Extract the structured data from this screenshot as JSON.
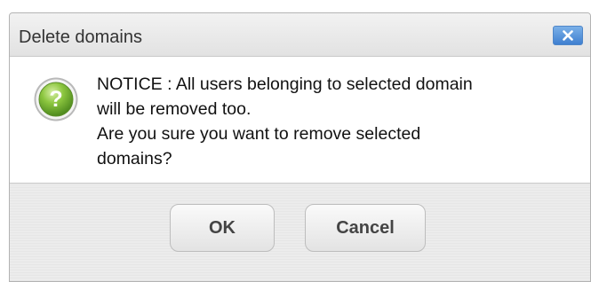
{
  "dialog": {
    "title": "Delete domains",
    "close_icon": "close-icon",
    "icon": "question-icon",
    "message_lines": [
      "NOTICE : All users belonging to selected domain",
      "will be removed too.",
      "Are you sure you want to remove selected",
      "domains?"
    ],
    "buttons": {
      "ok_label": "OK",
      "cancel_label": "Cancel"
    }
  },
  "colors": {
    "close_button": "#3e7fd0",
    "question_icon": "#7cbf3a",
    "background": "#e4e4e4"
  }
}
